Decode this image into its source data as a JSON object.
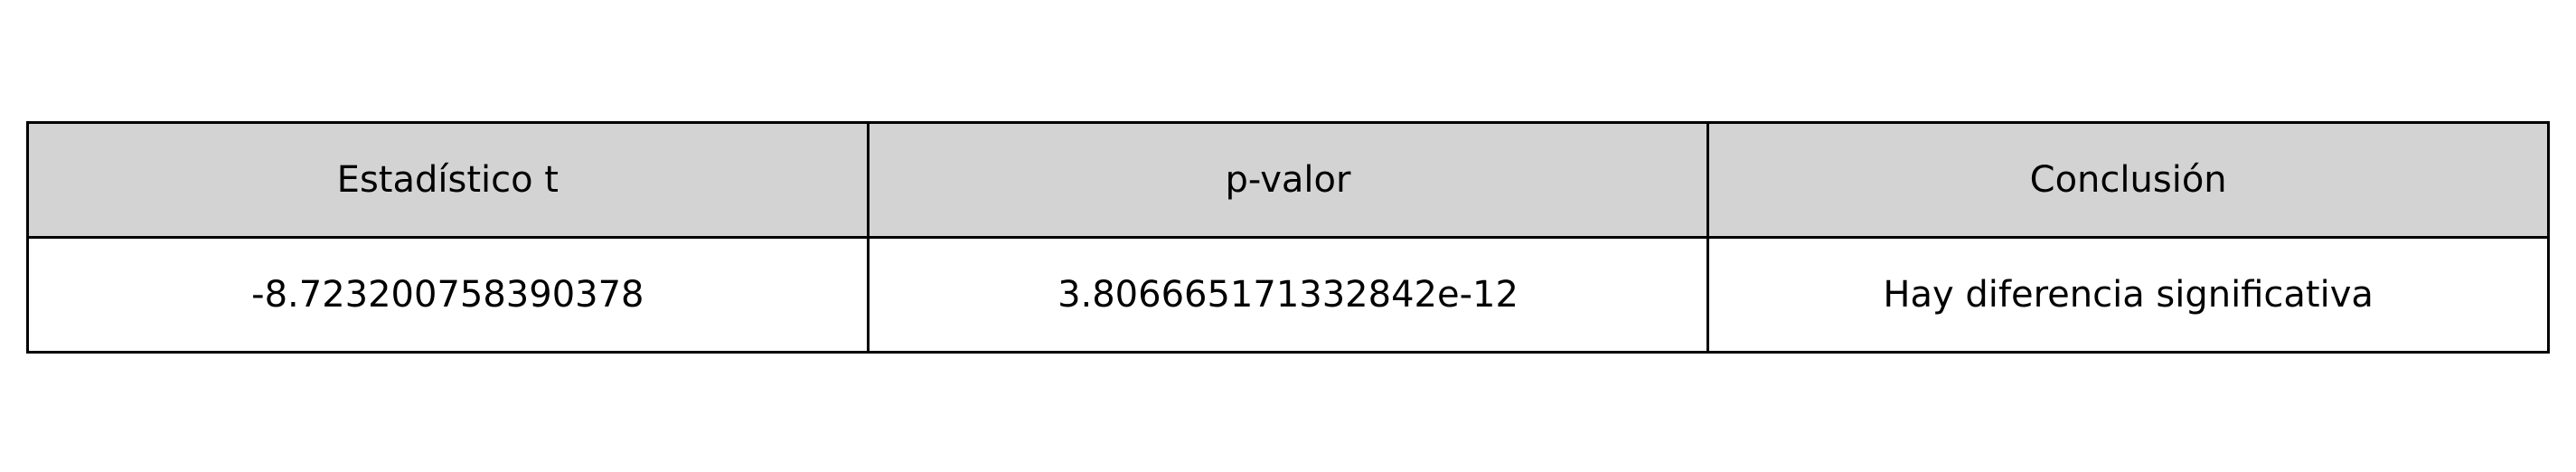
{
  "chart_data": {
    "type": "table",
    "columns": [
      "Estadístico t",
      "p-valor",
      "Conclusión"
    ],
    "rows": [
      [
        "-8.723200758390378",
        "3.806665171332842e-12",
        "Hay diferencia significativa"
      ]
    ],
    "colors": {
      "header_background": "#d3d3d3",
      "cell_background": "#ffffff",
      "border": "#000000"
    }
  }
}
